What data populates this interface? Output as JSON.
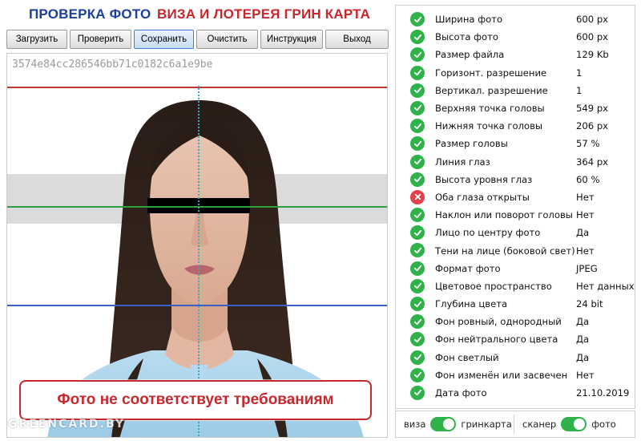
{
  "header": {
    "title_left": "ПРОВЕРКА ФОТО",
    "title_right": "ВИЗА И ЛОТЕРЕЯ ГРИН КАРТА"
  },
  "toolbar": {
    "buttons": [
      {
        "label": "Загрузить"
      },
      {
        "label": "Проверить"
      },
      {
        "label": "Сохранить"
      },
      {
        "label": "Очистить"
      },
      {
        "label": "Инструкция"
      },
      {
        "label": "Выход"
      }
    ]
  },
  "photo_panel": {
    "hash": "3574e84cc286546bb71c0182c6a1e9be",
    "result_message": "Фото не соответствует требованиям",
    "watermark": "GREENCARD.BY"
  },
  "checks": [
    {
      "label": "Ширина фото",
      "value": "600 px",
      "status": "ok"
    },
    {
      "label": "Высота фото",
      "value": "600 px",
      "status": "ok"
    },
    {
      "label": "Размер файла",
      "value": "129 Kb",
      "status": "ok"
    },
    {
      "label": "Горизонт. разрешение",
      "value": "1",
      "status": "ok"
    },
    {
      "label": "Вертикал. разрешение",
      "value": "1",
      "status": "ok"
    },
    {
      "label": "Верхняя точка головы",
      "value": "549 px",
      "status": "ok"
    },
    {
      "label": "Нижняя точка головы",
      "value": "206 px",
      "status": "ok"
    },
    {
      "label": "Размер головы",
      "value": "57 %",
      "status": "ok"
    },
    {
      "label": "Линия глаз",
      "value": "364 px",
      "status": "ok"
    },
    {
      "label": "Высота уровня глаз",
      "value": "60 %",
      "status": "ok"
    },
    {
      "label": "Оба глаза открыты",
      "value": "Нет",
      "status": "fail"
    },
    {
      "label": "Наклон или поворот головы",
      "value": "Нет",
      "status": "ok"
    },
    {
      "label": "Лицо по центру фото",
      "value": "Да",
      "status": "ok"
    },
    {
      "label": "Тени на лице (боковой свет)",
      "value": "Нет",
      "status": "ok"
    },
    {
      "label": "Формат фото",
      "value": "JPEG",
      "status": "ok"
    },
    {
      "label": "Цветовое пространство",
      "value": "Нет данных",
      "status": "ok"
    },
    {
      "label": "Глубина цвета",
      "value": "24 bit",
      "status": "ok"
    },
    {
      "label": "Фон ровный, однородный",
      "value": "Да",
      "status": "ok"
    },
    {
      "label": "Фон нейтрального цвета",
      "value": "Да",
      "status": "ok"
    },
    {
      "label": "Фон светлый",
      "value": "Да",
      "status": "ok"
    },
    {
      "label": "Фон изменён или засвечен",
      "value": "Нет",
      "status": "ok"
    },
    {
      "label": "Дата фото",
      "value": "21.10.2019",
      "status": "ok"
    }
  ],
  "toggles": {
    "left": {
      "off_label": "виза",
      "on_label": "гринкарта",
      "state": "on"
    },
    "right": {
      "off_label": "сканер",
      "on_label": "фото",
      "state": "on"
    }
  },
  "colors": {
    "ok": "#2fb24a",
    "fail": "#e5414c",
    "title_blue": "#1b3f9a",
    "title_red": "#c8262b",
    "top_guide": "#c0392b",
    "eye_guide": "#2e9e3e",
    "chin_guide": "#3b5fc4"
  }
}
